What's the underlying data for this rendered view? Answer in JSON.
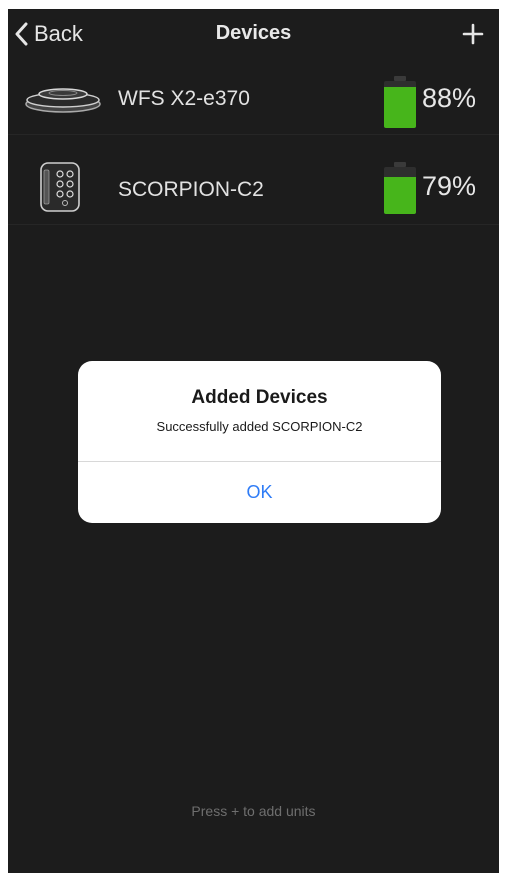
{
  "navbar": {
    "back_label": "Back",
    "title": "Devices",
    "add_label": "+"
  },
  "devices": [
    {
      "name": "WFS X2-e370",
      "battery_pct": 88,
      "battery_label": "88%",
      "icon": "disc-sensor-icon"
    },
    {
      "name": "SCORPION-C2",
      "battery_pct": 79,
      "battery_label": "79%",
      "icon": "control-unit-icon"
    }
  ],
  "alert": {
    "title": "Added Devices",
    "message": "Successfully added SCORPION-C2",
    "ok_label": "OK"
  },
  "hint": "Press + to add units",
  "colors": {
    "background": "#1c1c1c",
    "battery_fill": "#47b51b",
    "link_blue": "#2f7cf6"
  }
}
